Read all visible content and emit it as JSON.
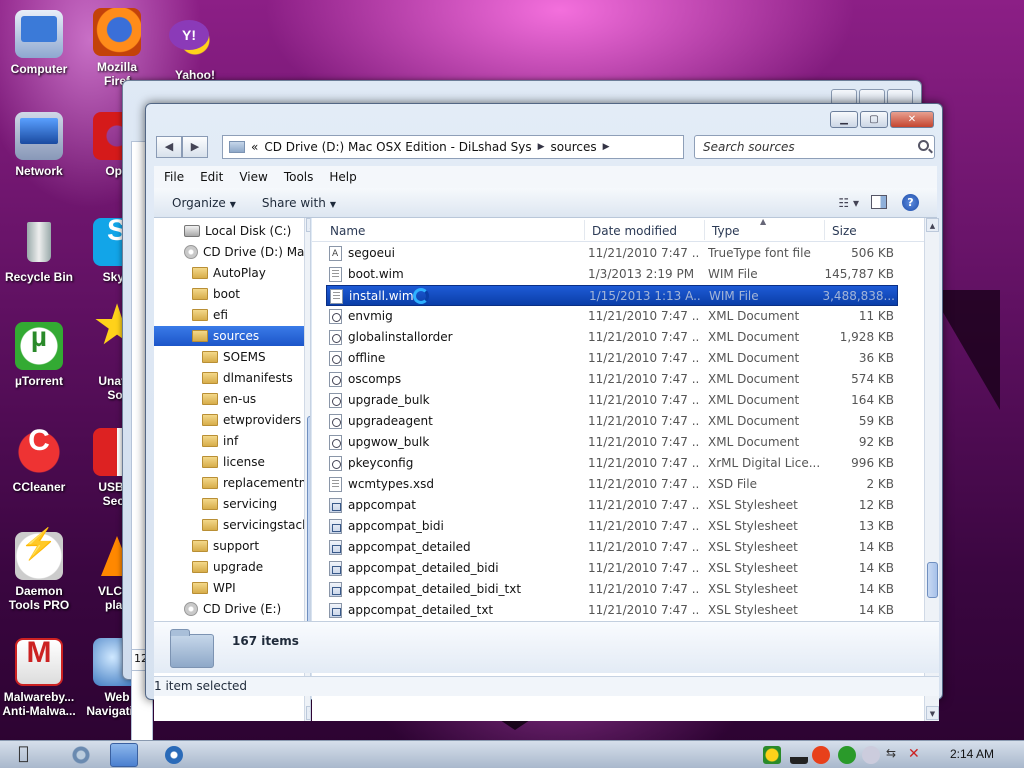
{
  "desktop": {
    "icons": [
      {
        "label": "Computer",
        "icon": "computer-icon"
      },
      {
        "label": "Mozilla\nFiref",
        "icon": "firefox-icon"
      },
      {
        "label": "Yahoo!\nM",
        "icon": "yahoo-messenger-icon"
      },
      {
        "label": "Network",
        "icon": "network-icon"
      },
      {
        "label": "Ope",
        "icon": "opera-icon"
      },
      {
        "label": "Recycle Bin",
        "icon": "recycle-bin-icon"
      },
      {
        "label": "Skyp",
        "icon": "skype-icon"
      },
      {
        "label": "µTorrent",
        "icon": "utorrent-icon"
      },
      {
        "label": "Unatte\nSof",
        "icon": "star-icon"
      },
      {
        "label": "CCleaner",
        "icon": "ccleaner-icon"
      },
      {
        "label": "USB D\nSecu",
        "icon": "usb-shield-icon"
      },
      {
        "label": "Daemon\nTools PRO",
        "icon": "daemon-tools-icon"
      },
      {
        "label": "VLC m\nplay",
        "icon": "vlc-icon"
      },
      {
        "label": "Malwareby...\nAnti-Malwa...",
        "icon": "malwarebytes-icon"
      },
      {
        "label": "Web\nNavigation",
        "icon": "web-navigation-icon"
      }
    ]
  },
  "back_window": {
    "fragment_text": "12"
  },
  "window": {
    "nav_back": "◀",
    "nav_forward": "▶",
    "address": {
      "overflow": "«",
      "segments": [
        "CD Drive (D:) Mac OSX Edition - DiLshad Sys",
        "sources"
      ]
    },
    "search_placeholder": "Search sources",
    "menu": [
      "File",
      "Edit",
      "View",
      "Tools",
      "Help"
    ],
    "toolbar": {
      "organize": "Organize",
      "share_with": "Share with"
    },
    "nav_pane": {
      "items": [
        {
          "label": "Local Disk (C:)",
          "type": "drive",
          "indent": 30
        },
        {
          "label": "CD Drive (D:) Mac",
          "type": "cd",
          "indent": 30
        },
        {
          "label": "AutoPlay",
          "type": "folder",
          "indent": 38
        },
        {
          "label": "boot",
          "type": "folder",
          "indent": 38
        },
        {
          "label": "efi",
          "type": "folder",
          "indent": 38
        },
        {
          "label": "sources",
          "type": "folder",
          "indent": 38,
          "selected": true
        },
        {
          "label": "SOEMS",
          "type": "folder",
          "indent": 48
        },
        {
          "label": "dlmanifests",
          "type": "folder",
          "indent": 48
        },
        {
          "label": "en-us",
          "type": "folder",
          "indent": 48
        },
        {
          "label": "etwproviders",
          "type": "folder",
          "indent": 48
        },
        {
          "label": "inf",
          "type": "folder",
          "indent": 48
        },
        {
          "label": "license",
          "type": "folder",
          "indent": 48
        },
        {
          "label": "replacementm",
          "type": "folder",
          "indent": 48
        },
        {
          "label": "servicing",
          "type": "folder",
          "indent": 48
        },
        {
          "label": "servicingstack",
          "type": "folder",
          "indent": 48
        },
        {
          "label": "support",
          "type": "folder",
          "indent": 38
        },
        {
          "label": "upgrade",
          "type": "folder",
          "indent": 38
        },
        {
          "label": "WPI",
          "type": "folder",
          "indent": 38
        },
        {
          "label": "CD Drive (E:)",
          "type": "cd",
          "indent": 30
        }
      ]
    },
    "columns": {
      "name": "Name",
      "date": "Date modified",
      "type": "Type",
      "size": "Size"
    },
    "files": [
      {
        "name": "segoeui",
        "date": "11/21/2010 7:47 ...",
        "type": "TrueType font file",
        "size": "506 KB",
        "icon": "font"
      },
      {
        "name": "boot.wim",
        "date": "1/3/2013 2:19 PM",
        "type": "WIM File",
        "size": "145,787 KB",
        "icon": "wim"
      },
      {
        "name": "install.wim",
        "date": "1/15/2013 1:13 A...",
        "type": "WIM File",
        "size": "3,488,838...",
        "icon": "wim",
        "selected": true
      },
      {
        "name": "envmig",
        "date": "11/21/2010 7:47 ...",
        "type": "XML Document",
        "size": "11 KB",
        "icon": "xml"
      },
      {
        "name": "globalinstallorder",
        "date": "11/21/2010 7:47 ...",
        "type": "XML Document",
        "size": "1,928 KB",
        "icon": "xml"
      },
      {
        "name": "offline",
        "date": "11/21/2010 7:47 ...",
        "type": "XML Document",
        "size": "36 KB",
        "icon": "xml"
      },
      {
        "name": "oscomps",
        "date": "11/21/2010 7:47 ...",
        "type": "XML Document",
        "size": "574 KB",
        "icon": "xml"
      },
      {
        "name": "upgrade_bulk",
        "date": "11/21/2010 7:47 ...",
        "type": "XML Document",
        "size": "164 KB",
        "icon": "xml"
      },
      {
        "name": "upgradeagent",
        "date": "11/21/2010 7:47 ...",
        "type": "XML Document",
        "size": "59 KB",
        "icon": "xml"
      },
      {
        "name": "upgwow_bulk",
        "date": "11/21/2010 7:47 ...",
        "type": "XML Document",
        "size": "92 KB",
        "icon": "xml"
      },
      {
        "name": "pkeyconfig",
        "date": "11/21/2010 7:47 ...",
        "type": "XrML Digital Lice...",
        "size": "996 KB",
        "icon": "xml"
      },
      {
        "name": "wcmtypes.xsd",
        "date": "11/21/2010 7:47 ...",
        "type": "XSD File",
        "size": "2 KB",
        "icon": "wim"
      },
      {
        "name": "appcompat",
        "date": "11/21/2010 7:47 ...",
        "type": "XSL Stylesheet",
        "size": "12 KB",
        "icon": "xsl"
      },
      {
        "name": "appcompat_bidi",
        "date": "11/21/2010 7:47 ...",
        "type": "XSL Stylesheet",
        "size": "13 KB",
        "icon": "xsl"
      },
      {
        "name": "appcompat_detailed",
        "date": "11/21/2010 7:47 ...",
        "type": "XSL Stylesheet",
        "size": "14 KB",
        "icon": "xsl"
      },
      {
        "name": "appcompat_detailed_bidi",
        "date": "11/21/2010 7:47 ...",
        "type": "XSL Stylesheet",
        "size": "14 KB",
        "icon": "xsl"
      },
      {
        "name": "appcompat_detailed_bidi_txt",
        "date": "11/21/2010 7:47 ...",
        "type": "XSL Stylesheet",
        "size": "14 KB",
        "icon": "xsl"
      },
      {
        "name": "appcompat_detailed_txt",
        "date": "11/21/2010 7:47 ...",
        "type": "XSL Stylesheet",
        "size": "14 KB",
        "icon": "xsl"
      }
    ],
    "details": {
      "item_count": "167 items"
    },
    "status": {
      "selection": "1 item selected"
    }
  },
  "taskbar": {
    "clock": "2:14 AM"
  },
  "colors": {
    "selection": "#0a3ea8",
    "nav_selection": "#1c55c9",
    "desktop": "#5a0f5d"
  }
}
